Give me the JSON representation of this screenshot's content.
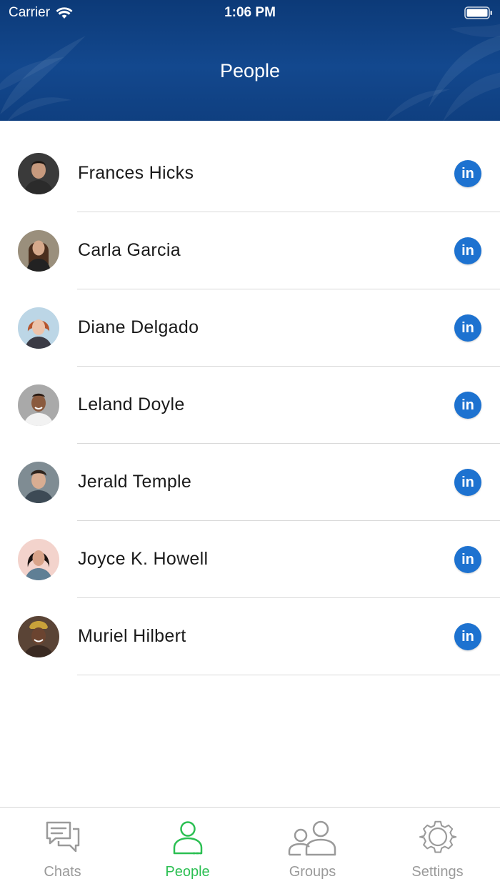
{
  "status_bar": {
    "carrier": "Carrier",
    "time": "1:06 PM"
  },
  "header": {
    "title": "People"
  },
  "people": [
    {
      "name": "Frances Hicks",
      "link_label": "in"
    },
    {
      "name": "Carla Garcia",
      "link_label": "in"
    },
    {
      "name": "Diane Delgado",
      "link_label": "in"
    },
    {
      "name": "Leland Doyle",
      "link_label": "in"
    },
    {
      "name": "Jerald Temple",
      "link_label": "in"
    },
    {
      "name": "Joyce K. Howell",
      "link_label": "in"
    },
    {
      "name": "Muriel Hilbert",
      "link_label": "in"
    }
  ],
  "tabbar": {
    "tabs": [
      {
        "label": "Chats",
        "icon": "chat-icon",
        "active": false
      },
      {
        "label": "People",
        "icon": "person-icon",
        "active": true
      },
      {
        "label": "Groups",
        "icon": "groups-icon",
        "active": false
      },
      {
        "label": "Settings",
        "icon": "gear-icon",
        "active": false
      }
    ]
  },
  "colors": {
    "header_bg": "#13488e",
    "accent_active": "#2bbf52",
    "inactive_tab": "#9a9a9a",
    "linkedin_blue": "#1d72d0"
  }
}
